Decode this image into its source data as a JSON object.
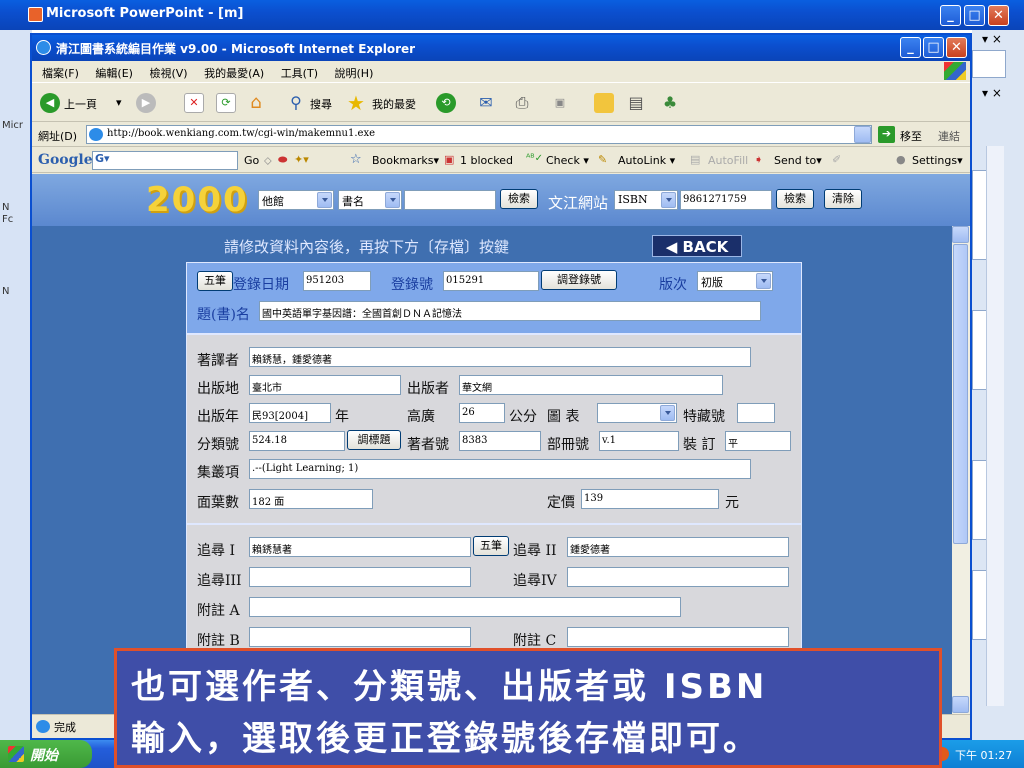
{
  "ppt_window": {
    "title": "Microsoft PowerPoint - [m]",
    "left_labels": [
      "Micr",
      "N",
      "Fc",
      "N"
    ]
  },
  "ie_window": {
    "title": "清江圖書系統編目作業 v9.00 - Microsoft Internet Explorer",
    "menu": [
      "檔案(F)",
      "編輯(E)",
      "檢視(V)",
      "我的最愛(A)",
      "工具(T)",
      "說明(H)"
    ],
    "toolbar": {
      "back": "上一頁",
      "search": "搜尋",
      "favorites": "我的最愛"
    },
    "address": {
      "label": "網址(D)",
      "url": "http://book.wenkiang.com.tw/cgi-win/makemnu1.exe",
      "go": "移至",
      "links": "連結"
    },
    "googlebar": {
      "logo": "Google",
      "go": "Go",
      "bookmarks": "Bookmarks▾",
      "blocked": "1 blocked",
      "check": "Check ▾",
      "autolink": "AutoLink ▾",
      "autofill": "AutoFill",
      "sendto": "Send to▾",
      "settings": "Settings▾"
    },
    "status": "完成"
  },
  "banner": {
    "logo": "2000",
    "library_select": "他館",
    "field_select": "書名",
    "search_value": "",
    "search_button": "檢索",
    "site_label": "文江網站",
    "site_select": "ISBN",
    "isbn_value": "9861271759",
    "search_button2": "檢索",
    "clear_button": "清除"
  },
  "form": {
    "instruction": "請修改資料內容後，再按下方〔存檔〕按鍵",
    "back_button": "◀ BACK",
    "wubi_button": "五筆",
    "reg_date_label": "登錄日期",
    "reg_date": "951203",
    "reg_no_label": "登錄號",
    "reg_no": "015291",
    "adjust_reg_button": "調登錄號",
    "edition_label": "版次",
    "edition": "初版",
    "title_label": "題(書)名",
    "title": "國中英語單字基因譜：全國首創ＤＮＡ記憶法",
    "author_label": "著譯者",
    "author": "賴銹慧，鍾愛德著",
    "place_label": "出版地",
    "place": "臺北市",
    "publisher_label": "出版者",
    "publisher": "華文網",
    "year_label": "出版年",
    "year": "民93[2004]",
    "year_unit": "年",
    "height_label": "高廣",
    "height": "26",
    "height_unit": "公分",
    "illus_label": "圖 表",
    "illus": "",
    "special_label": "特藏號",
    "special": "",
    "class_label": "分類號",
    "class_no": "524.18",
    "adjust_title_button": "調標題",
    "author_no_label": "著者號",
    "author_no": "8383",
    "volume_label": "部冊號",
    "volume": "v.1",
    "binding_label": "裝 訂",
    "binding": "平",
    "series_label": "集叢項",
    "series": ".--(Light Learning; 1)",
    "pages_label": "面葉數",
    "pages": "182 面",
    "price_label": "定價",
    "price": "139",
    "price_unit": "元",
    "trace1_label": "追尋 I",
    "trace1": "賴銹慧著",
    "trace_wubi_button": "五筆",
    "trace2_label": "追尋 II",
    "trace2": "鍾愛德著",
    "trace3_label": "追尋III",
    "trace3": "",
    "trace4_label": "追尋IV",
    "trace4": "",
    "noteA_label": "附註 A",
    "noteA": "",
    "noteB_label": "附註 B",
    "noteB": "",
    "noteC_label": "附註 C",
    "noteC": ""
  },
  "taskbar": {
    "start": "開始",
    "clock": "下午 01:27"
  },
  "caption": {
    "line1": "也可選作者、分類號、出版者或 ISBN",
    "line2": "輸入，選取後更正登錄號後存檔即可。"
  },
  "colors": {
    "xp_blue": "#0a4fd0",
    "form_blue": "#7fa8ea",
    "page_bg": "#3f6fb0",
    "caption_bg": "#3f4ea8",
    "caption_border": "#e0502a",
    "logo_yellow": "#f5d23a"
  }
}
